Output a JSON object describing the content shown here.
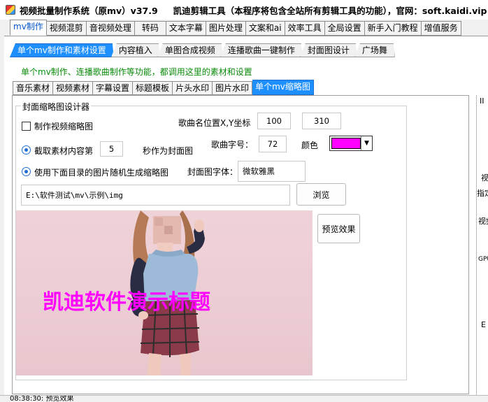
{
  "window": {
    "title_left": "视频批量制作系统（原mv）v37.9",
    "title_right": "凯迪剪辑工具（本程序将包含全站所有剪辑工具的功能），官网：soft.kaidi.vip"
  },
  "main_tabs": [
    "mv制作",
    "视频混剪",
    "音视频处理",
    "转码",
    "文本字幕",
    "图片处理",
    "文案和ai",
    "效率工具",
    "全局设置",
    "新手入门教程",
    "增值服务"
  ],
  "sub_tabs": [
    "单个mv制作和素材设置",
    "内容植入",
    "单图合成视频",
    "连播歌曲一键制作",
    "封面图设计",
    "广场舞"
  ],
  "notice": "单个mv制作、连播歌曲制作等功能，都调用这里的素材和设置",
  "asset_tabs": [
    "音乐素材",
    "视频素材",
    "字幕设置",
    "标题模板",
    "片头水印",
    "图片水印",
    "单个mv缩略图"
  ],
  "group": {
    "title": "封面缩略图设计器",
    "make_thumbnail_label": "制作视频缩略图",
    "capture_label": "截取素材内容第",
    "capture_seconds": "5",
    "capture_suffix": "秒作为封面图",
    "random_image_label": "使用下面目录的图片随机生成缩略图",
    "song_pos_label": "歌曲名位置X,Y坐标",
    "pos_x": "100",
    "pos_y": "310",
    "font_size_label": "歌曲字号：",
    "font_size": "72",
    "color_label": "颜色",
    "color_value": "#ff00ff",
    "font_label": "封面图字体：",
    "font_value": "微软雅黑",
    "path_value": "E:\\软件测试\\mv\\示例\\img",
    "browse_label": "浏览",
    "preview_button_label": "预览效果",
    "preview_title": "凯迪软件演示标题"
  },
  "right_panel": {
    "texts": [
      "II",
      "视",
      "指定",
      "视频",
      "GPU",
      "E"
    ]
  },
  "status": "08:38:30: 预览效果"
}
